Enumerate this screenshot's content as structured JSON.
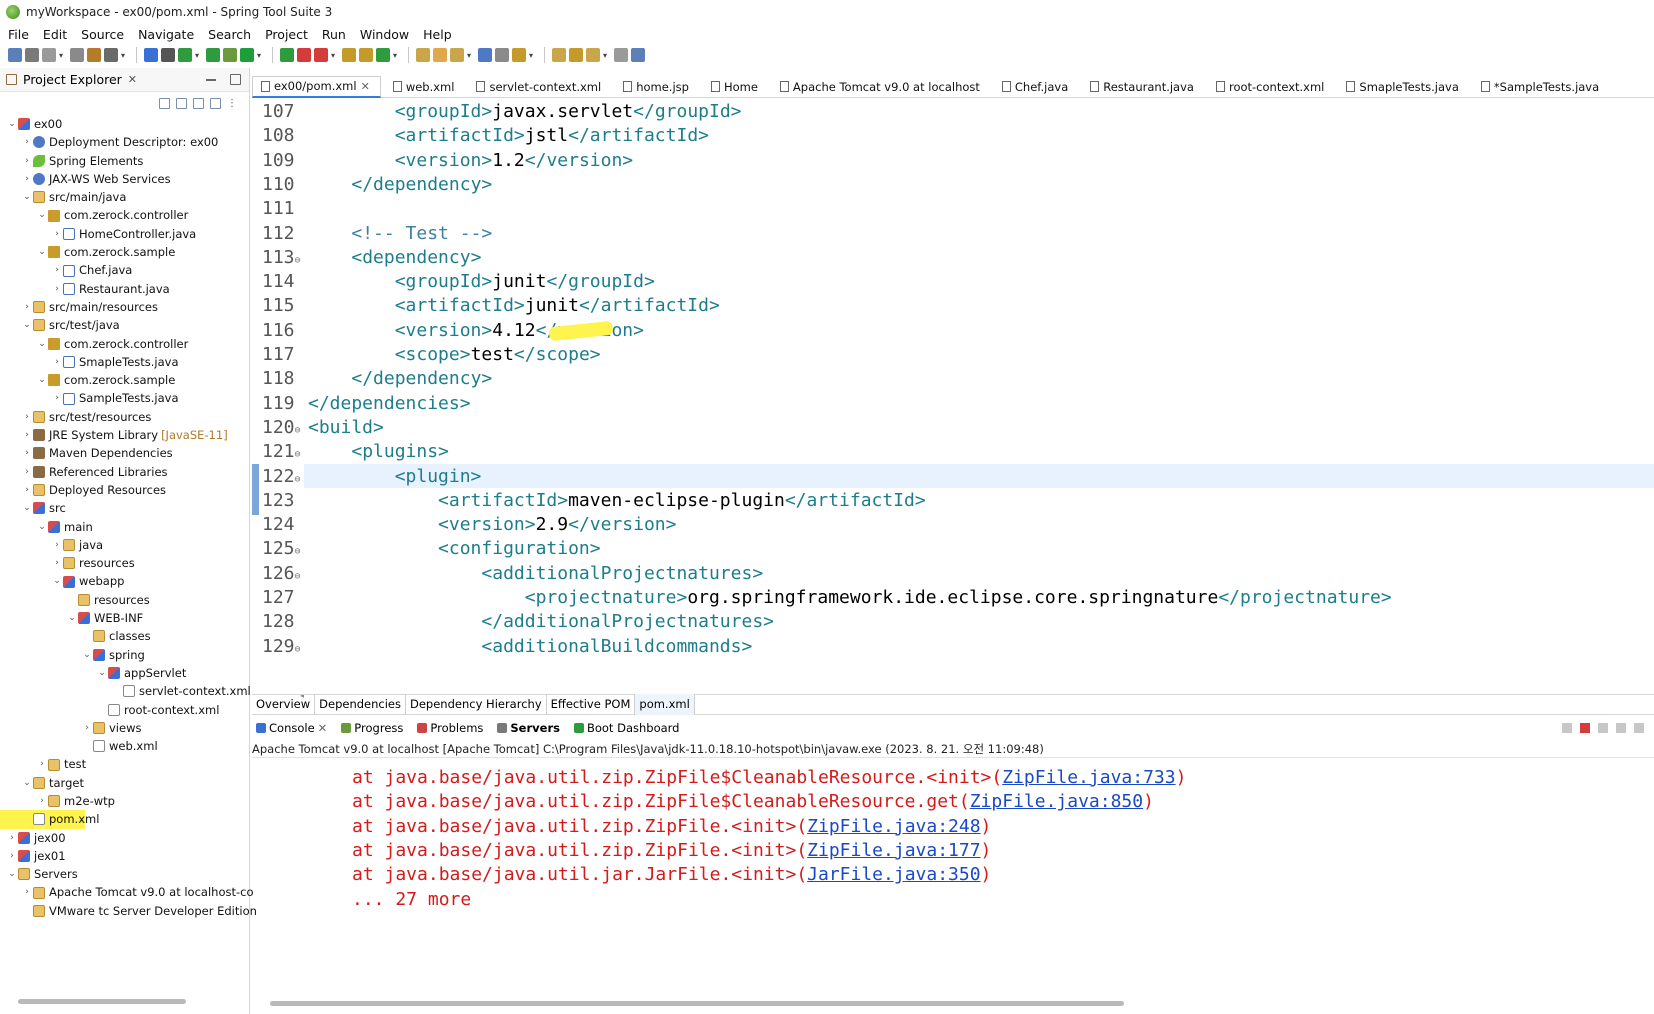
{
  "window": {
    "title": "myWorkspace - ex00/pom.xml - Spring Tool Suite 3"
  },
  "menu": [
    "File",
    "Edit",
    "Source",
    "Navigate",
    "Search",
    "Project",
    "Run",
    "Window",
    "Help"
  ],
  "explorer": {
    "title": "Project Explorer",
    "tree": [
      {
        "label": "ex00",
        "depth": 0,
        "tw": "⌄",
        "icon": "proj"
      },
      {
        "label": "Deployment Descriptor: ex00",
        "depth": 1,
        "tw": "›",
        "icon": "web"
      },
      {
        "label": "Spring Elements",
        "depth": 1,
        "tw": "›",
        "icon": "leaf"
      },
      {
        "label": "JAX-WS Web Services",
        "depth": 1,
        "tw": "›",
        "icon": "web"
      },
      {
        "label": "src/main/java",
        "depth": 1,
        "tw": "⌄",
        "icon": "folder"
      },
      {
        "label": "com.zerock.controller",
        "depth": 2,
        "tw": "⌄",
        "icon": "pkg"
      },
      {
        "label": "HomeController.java",
        "depth": 3,
        "tw": "›",
        "icon": "java"
      },
      {
        "label": "com.zerock.sample",
        "depth": 2,
        "tw": "⌄",
        "icon": "pkg"
      },
      {
        "label": "Chef.java",
        "depth": 3,
        "tw": "›",
        "icon": "java"
      },
      {
        "label": "Restaurant.java",
        "depth": 3,
        "tw": "›",
        "icon": "java"
      },
      {
        "label": "src/main/resources",
        "depth": 1,
        "tw": "›",
        "icon": "folder"
      },
      {
        "label": "src/test/java",
        "depth": 1,
        "tw": "⌄",
        "icon": "folder"
      },
      {
        "label": "com.zerock.controller",
        "depth": 2,
        "tw": "⌄",
        "icon": "pkg"
      },
      {
        "label": "SmapleTests.java",
        "depth": 3,
        "tw": "›",
        "icon": "java"
      },
      {
        "label": "com.zerock.sample",
        "depth": 2,
        "tw": "⌄",
        "icon": "pkg"
      },
      {
        "label": "SampleTests.java",
        "depth": 3,
        "tw": "›",
        "icon": "java"
      },
      {
        "label": "src/test/resources",
        "depth": 1,
        "tw": "›",
        "icon": "folder"
      },
      {
        "label": "JRE System Library",
        "deco": "[JavaSE-11]",
        "depth": 1,
        "tw": "›",
        "icon": "lib"
      },
      {
        "label": "Maven Dependencies",
        "depth": 1,
        "tw": "›",
        "icon": "lib"
      },
      {
        "label": "Referenced Libraries",
        "depth": 1,
        "tw": "›",
        "icon": "lib"
      },
      {
        "label": "Deployed Resources",
        "depth": 1,
        "tw": "›",
        "icon": "folder"
      },
      {
        "label": "src",
        "depth": 1,
        "tw": "⌄",
        "icon": "proj"
      },
      {
        "label": "main",
        "depth": 2,
        "tw": "⌄",
        "icon": "proj"
      },
      {
        "label": "java",
        "depth": 3,
        "tw": "›",
        "icon": "folder"
      },
      {
        "label": "resources",
        "depth": 3,
        "tw": "›",
        "icon": "folder"
      },
      {
        "label": "webapp",
        "depth": 3,
        "tw": "⌄",
        "icon": "proj"
      },
      {
        "label": "resources",
        "depth": 4,
        "tw": "",
        "icon": "folder"
      },
      {
        "label": "WEB-INF",
        "depth": 4,
        "tw": "⌄",
        "icon": "proj"
      },
      {
        "label": "classes",
        "depth": 5,
        "tw": "",
        "icon": "folder"
      },
      {
        "label": "spring",
        "depth": 5,
        "tw": "⌄",
        "icon": "proj"
      },
      {
        "label": "appServlet",
        "depth": 6,
        "tw": "⌄",
        "icon": "proj"
      },
      {
        "label": "servlet-context.xml",
        "depth": 7,
        "tw": "",
        "icon": "xml"
      },
      {
        "label": "root-context.xml",
        "depth": 6,
        "tw": "",
        "icon": "xml"
      },
      {
        "label": "views",
        "depth": 5,
        "tw": "›",
        "icon": "folder"
      },
      {
        "label": "web.xml",
        "depth": 5,
        "tw": "",
        "icon": "xml"
      },
      {
        "label": "test",
        "depth": 2,
        "tw": "›",
        "icon": "folder"
      },
      {
        "label": "target",
        "depth": 1,
        "tw": "⌄",
        "icon": "folder"
      },
      {
        "label": "m2e-wtp",
        "depth": 2,
        "tw": "›",
        "icon": "folder"
      },
      {
        "label": "pom.xml",
        "depth": 1,
        "tw": "",
        "icon": "xml",
        "highlight": true
      },
      {
        "label": "jex00",
        "depth": 0,
        "tw": "›",
        "icon": "proj"
      },
      {
        "label": "jex01",
        "depth": 0,
        "tw": "›",
        "icon": "proj"
      },
      {
        "label": "Servers",
        "depth": 0,
        "tw": "⌄",
        "icon": "folder"
      },
      {
        "label": "Apache Tomcat v9.0  at localhost-co",
        "depth": 1,
        "tw": "›",
        "icon": "folder"
      },
      {
        "label": "VMware tc Server Developer Edition",
        "depth": 1,
        "tw": "",
        "icon": "folder"
      }
    ]
  },
  "editor": {
    "tabs": [
      {
        "label": "ex00/pom.xml",
        "active": true,
        "close": "✕"
      },
      {
        "label": "web.xml"
      },
      {
        "label": "servlet-context.xml"
      },
      {
        "label": "home.jsp"
      },
      {
        "label": "Home"
      },
      {
        "label": "Apache Tomcat v9.0  at localhost"
      },
      {
        "label": "Chef.java"
      },
      {
        "label": "Restaurant.java"
      },
      {
        "label": "root-context.xml"
      },
      {
        "label": "SmapleTests.java"
      },
      {
        "label": "*SampleTests.java"
      }
    ],
    "lines": [
      {
        "n": "107",
        "fold": "",
        "indent": "        ",
        "parts": [
          [
            "tg",
            "<groupId>"
          ],
          [
            "tx",
            "javax.servlet"
          ],
          [
            "tg",
            "</groupId>"
          ]
        ]
      },
      {
        "n": "108",
        "fold": "",
        "indent": "        ",
        "parts": [
          [
            "tg",
            "<artifactId>"
          ],
          [
            "tx",
            "jstl"
          ],
          [
            "tg",
            "</artifactId>"
          ]
        ]
      },
      {
        "n": "109",
        "fold": "",
        "indent": "        ",
        "parts": [
          [
            "tg",
            "<version>"
          ],
          [
            "tx",
            "1.2"
          ],
          [
            "tg",
            "</version>"
          ]
        ]
      },
      {
        "n": "110",
        "fold": "",
        "indent": "    ",
        "parts": [
          [
            "tg",
            "</dependency>"
          ]
        ]
      },
      {
        "n": "111",
        "fold": "",
        "indent": "",
        "parts": []
      },
      {
        "n": "112",
        "fold": "",
        "indent": "    ",
        "parts": [
          [
            "cm",
            "<!-- Test -->"
          ]
        ]
      },
      {
        "n": "113",
        "fold": "⊖",
        "indent": "    ",
        "parts": [
          [
            "tg",
            "<dependency>"
          ]
        ]
      },
      {
        "n": "114",
        "fold": "",
        "indent": "        ",
        "parts": [
          [
            "tg",
            "<groupId>"
          ],
          [
            "tx",
            "junit"
          ],
          [
            "tg",
            "</groupId>"
          ]
        ]
      },
      {
        "n": "115",
        "fold": "",
        "indent": "        ",
        "parts": [
          [
            "tg",
            "<artifactId>"
          ],
          [
            "tx",
            "junit"
          ],
          [
            "tg",
            "</artifactId>"
          ]
        ]
      },
      {
        "n": "116",
        "fold": "",
        "indent": "        ",
        "parts": [
          [
            "tg",
            "<version>"
          ],
          [
            "tx",
            "4.12"
          ],
          [
            "tg",
            "</version>"
          ]
        ]
      },
      {
        "n": "117",
        "fold": "",
        "indent": "        ",
        "parts": [
          [
            "tg",
            "<scope>"
          ],
          [
            "tx",
            "test"
          ],
          [
            "tg",
            "</scope>"
          ]
        ]
      },
      {
        "n": "118",
        "fold": "",
        "indent": "    ",
        "parts": [
          [
            "tg",
            "</dependency>"
          ]
        ]
      },
      {
        "n": "119",
        "fold": "",
        "indent": "",
        "parts": [
          [
            "tg",
            "</dependencies>"
          ]
        ]
      },
      {
        "n": "120",
        "fold": "⊖",
        "indent": "",
        "parts": [
          [
            "tg",
            "<build>"
          ]
        ]
      },
      {
        "n": "121",
        "fold": "⊖",
        "indent": "    ",
        "parts": [
          [
            "tg",
            "<plugins>"
          ]
        ]
      },
      {
        "n": "122",
        "fold": "⊖",
        "indent": "        ",
        "parts": [
          [
            "tg",
            "<plugin>"
          ]
        ]
      },
      {
        "n": "123",
        "fold": "",
        "indent": "            ",
        "parts": [
          [
            "tg",
            "<artifactId>"
          ],
          [
            "tx",
            "maven-eclipse-plugin"
          ],
          [
            "tg",
            "</artifactId>"
          ]
        ]
      },
      {
        "n": "124",
        "fold": "",
        "indent": "            ",
        "parts": [
          [
            "tg",
            "<version>"
          ],
          [
            "tx",
            "2.9"
          ],
          [
            "tg",
            "</version>"
          ]
        ]
      },
      {
        "n": "125",
        "fold": "⊖",
        "indent": "            ",
        "parts": [
          [
            "tg",
            "<configuration>"
          ]
        ]
      },
      {
        "n": "126",
        "fold": "⊖",
        "indent": "                ",
        "parts": [
          [
            "tg",
            "<additionalProjectnatures>"
          ]
        ]
      },
      {
        "n": "127",
        "fold": "",
        "indent": "                    ",
        "parts": [
          [
            "tg",
            "<projectnature>"
          ],
          [
            "tx",
            "org.springframework.ide.eclipse.core.springnature"
          ],
          [
            "tg",
            "</projectnature>"
          ]
        ]
      },
      {
        "n": "128",
        "fold": "",
        "indent": "                ",
        "parts": [
          [
            "tg",
            "</additionalProjectnatures>"
          ]
        ]
      },
      {
        "n": "129",
        "fold": "⊖",
        "indent": "                ",
        "parts": [
          [
            "tg",
            "<additionalBuildcommands>"
          ]
        ]
      }
    ]
  },
  "pom_tabs": [
    {
      "label": "Overview"
    },
    {
      "label": "Dependencies"
    },
    {
      "label": "Dependency Hierarchy"
    },
    {
      "label": "Effective POM"
    },
    {
      "label": "pom.xml",
      "active": true
    }
  ],
  "console": {
    "tabs": [
      {
        "label": "Console",
        "close": "✕",
        "color": "#3a6fd6"
      },
      {
        "label": "Progress",
        "color": "#6a9a3a"
      },
      {
        "label": "Problems",
        "color": "#c44"
      },
      {
        "label": "Servers",
        "active": true,
        "color": "#7a7a7a"
      },
      {
        "label": "Boot Dashboard",
        "color": "#2e9b3e"
      }
    ],
    "header": "Apache Tomcat v9.0  at localhost [Apache Tomcat] C:\\Program Files\\Java\\jdk-11.0.18.10-hotspot\\bin\\javaw.exe  (2023. 8. 21. 오전 11:09:48)",
    "lines": [
      {
        "pre": "at java.base/java.util.zip.ZipFile$CleanableResource.<init>(",
        "link": "ZipFile.java:733",
        "post": ")"
      },
      {
        "pre": "at java.base/java.util.zip.ZipFile$CleanableResource.get(",
        "link": "ZipFile.java:850",
        "post": ")"
      },
      {
        "pre": "at java.base/java.util.zip.ZipFile.<init>(",
        "link": "ZipFile.java:248",
        "post": ")"
      },
      {
        "pre": "at java.base/java.util.zip.ZipFile.<init>(",
        "link": "ZipFile.java:177",
        "post": ")"
      },
      {
        "pre": "at java.base/java.util.jar.JarFile.<init>(",
        "link": "JarFile.java:350",
        "post": ")"
      },
      {
        "pre": "... 27 more",
        "link": "",
        "post": ""
      }
    ]
  },
  "colors": {
    "tag": "#1d7d8c",
    "comment": "#3f7f9f",
    "error": "#d41a1a",
    "link": "#1a49c7",
    "highlight": "#fff34d"
  }
}
